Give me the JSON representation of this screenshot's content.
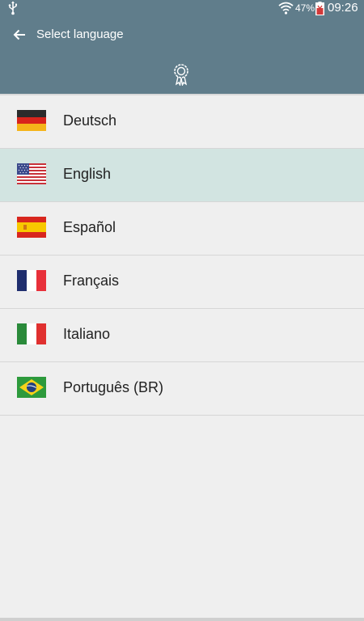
{
  "status_bar": {
    "usb_icon": "usb-icon",
    "wifi_icon": "wifi-icon",
    "battery_percent": "47%",
    "battery_icon": "battery-icon",
    "time": "09:26"
  },
  "app_bar": {
    "back_icon": "arrow-left-icon",
    "title": "Select language",
    "badge_icon": "award-icon",
    "color": "#607d8b"
  },
  "languages": [
    {
      "label": "Deutsch",
      "flag": "de-flag",
      "selected": false
    },
    {
      "label": "English",
      "flag": "us-flag",
      "selected": true
    },
    {
      "label": "Español",
      "flag": "es-flag",
      "selected": false
    },
    {
      "label": "Français",
      "flag": "fr-flag",
      "selected": false
    },
    {
      "label": "Italiano",
      "flag": "it-flag",
      "selected": false
    },
    {
      "label": "Português (BR)",
      "flag": "br-flag",
      "selected": false
    }
  ],
  "colors": {
    "selected_row": "#d2e4e1",
    "background": "#efefef"
  }
}
